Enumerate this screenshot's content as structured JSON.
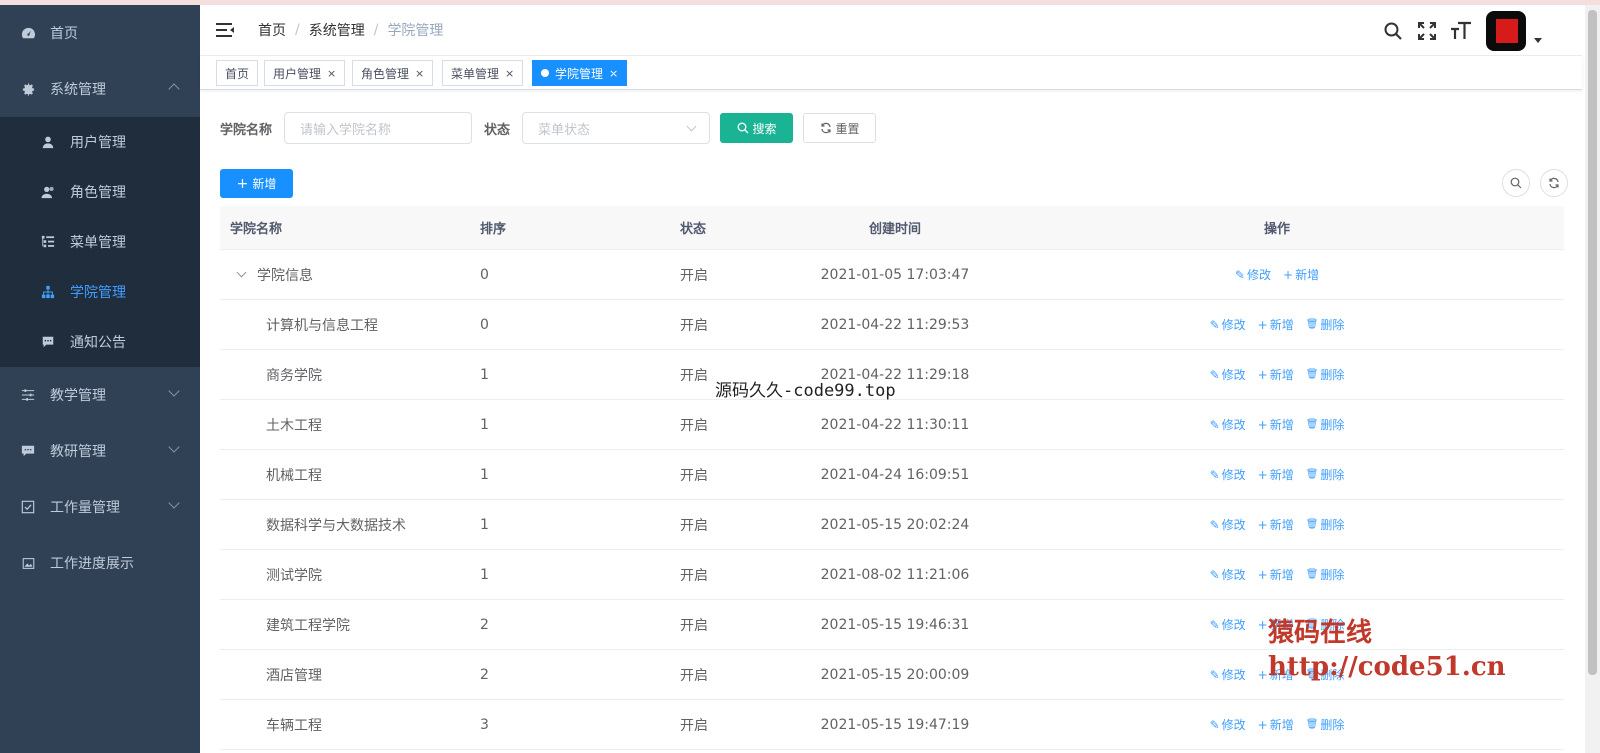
{
  "sidebar": {
    "items": [
      {
        "label": "首页",
        "icon": "dashboard-icon"
      },
      {
        "label": "系统管理",
        "icon": "gear-icon",
        "expanded": true
      },
      {
        "label": "教学管理",
        "icon": "sliders-icon"
      },
      {
        "label": "教研管理",
        "icon": "chat-icon"
      },
      {
        "label": "工作量管理",
        "icon": "checkbox-icon"
      },
      {
        "label": "工作进度展示",
        "icon": "image-icon"
      }
    ],
    "submenu": [
      {
        "label": "用户管理",
        "icon": "user-icon"
      },
      {
        "label": "角色管理",
        "icon": "users-icon"
      },
      {
        "label": "菜单管理",
        "icon": "tree-table-icon"
      },
      {
        "label": "学院管理",
        "icon": "org-tree-icon",
        "active": true
      },
      {
        "label": "通知公告",
        "icon": "message-icon"
      }
    ]
  },
  "breadcrumb": {
    "items": [
      "首页",
      "系统管理",
      "学院管理"
    ],
    "sep": "/"
  },
  "tags": [
    {
      "label": "首页"
    },
    {
      "label": "用户管理",
      "close": "×"
    },
    {
      "label": "角色管理",
      "close": "×"
    },
    {
      "label": "菜单管理",
      "close": "×"
    },
    {
      "label": "学院管理",
      "close": "×",
      "active": true
    }
  ],
  "search": {
    "name_label": "学院名称",
    "name_placeholder": "请输入学院名称",
    "status_label": "状态",
    "status_placeholder": "菜单状态",
    "search_btn": "搜索",
    "reset_btn": "重置"
  },
  "toolbar": {
    "add_btn": "新增"
  },
  "table": {
    "headers": [
      "学院名称",
      "排序",
      "状态",
      "创建时间",
      "操作"
    ],
    "ops": {
      "edit": "修改",
      "add": "新增",
      "delete": "删除"
    },
    "rows": [
      {
        "name": "学院信息",
        "order": "0",
        "status": "开启",
        "created": "2021-01-05 17:03:47",
        "parent": true
      },
      {
        "name": "计算机与信息工程",
        "order": "0",
        "status": "开启",
        "created": "2021-04-22 11:29:53"
      },
      {
        "name": "商务学院",
        "order": "1",
        "status": "开启",
        "created": "2021-04-22 11:29:18"
      },
      {
        "name": "土木工程",
        "order": "1",
        "status": "开启",
        "created": "2021-04-22 11:30:11"
      },
      {
        "name": "机械工程",
        "order": "1",
        "status": "开启",
        "created": "2021-04-24 16:09:51"
      },
      {
        "name": "数据科学与大数据技术",
        "order": "1",
        "status": "开启",
        "created": "2021-05-15 20:02:24"
      },
      {
        "name": "测试学院",
        "order": "1",
        "status": "开启",
        "created": "2021-08-02 11:21:06"
      },
      {
        "name": "建筑工程学院",
        "order": "2",
        "status": "开启",
        "created": "2021-05-15 19:46:31"
      },
      {
        "name": "酒店管理",
        "order": "2",
        "status": "开启",
        "created": "2021-05-15 20:00:09"
      },
      {
        "name": "车辆工程",
        "order": "3",
        "status": "开启",
        "created": "2021-05-15 19:47:19"
      }
    ]
  },
  "watermarks": {
    "center": "源码久久-code99.top",
    "corner_line1": "猿码在线",
    "corner_line2": "http://code51.cn"
  },
  "colors": {
    "sidebar_bg": "#304156",
    "submenu_bg": "#1f2d3d",
    "primary": "#1890ff",
    "search_btn": "#1ab394",
    "link": "#409eff"
  }
}
